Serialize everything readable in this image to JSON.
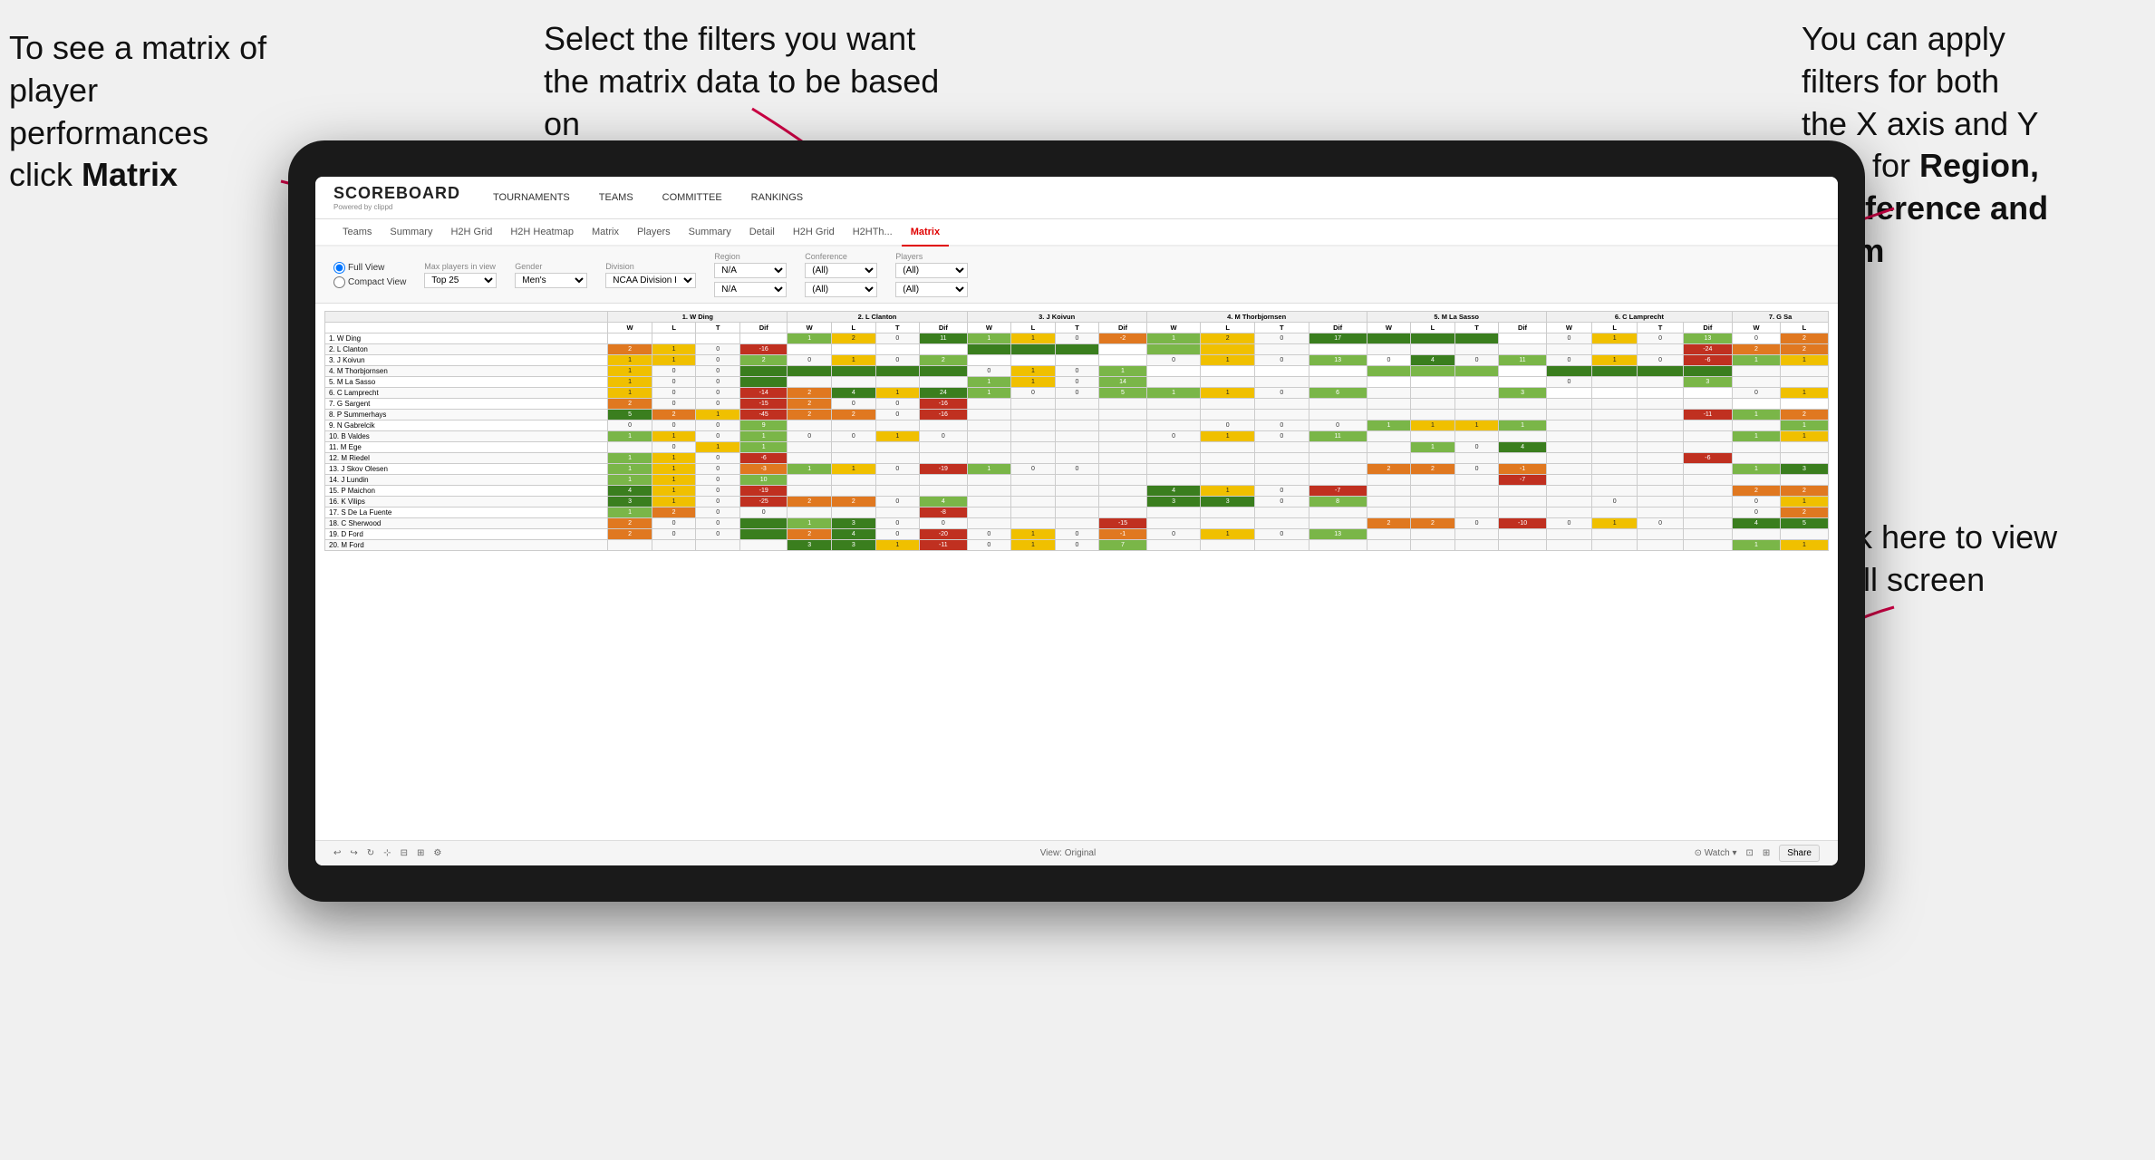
{
  "annotations": {
    "topleft": {
      "line1": "To see a matrix of",
      "line2": "player performances",
      "line3_normal": "click ",
      "line3_bold": "Matrix"
    },
    "topmid": {
      "text": "Select the filters you want the matrix data to be based on"
    },
    "topright": {
      "line1": "You  can apply",
      "line2": "filters for both",
      "line3": "the X axis and Y",
      "line4_normal": "Axis for ",
      "line4_bold": "Region,",
      "line5_bold": "Conference and",
      "line6_bold": "Team"
    },
    "bottomright": {
      "line1": "Click here to view",
      "line2": "in full screen"
    }
  },
  "app": {
    "logo": "SCOREBOARD",
    "logo_sub": "Powered by clippd",
    "nav_items": [
      "TOURNAMENTS",
      "TEAMS",
      "COMMITTEE",
      "RANKINGS"
    ],
    "sub_nav": [
      "Teams",
      "Summary",
      "H2H Grid",
      "H2H Heatmap",
      "Matrix",
      "Players",
      "Summary",
      "Detail",
      "H2H Grid",
      "H2HTh...",
      "Matrix"
    ],
    "active_tab": "Matrix",
    "filters": {
      "view_options": [
        "Full View",
        "Compact View"
      ],
      "max_players_label": "Max players in view",
      "max_players_value": "Top 25",
      "gender_label": "Gender",
      "gender_value": "Men's",
      "division_label": "Division",
      "division_value": "NCAA Division I",
      "region_label": "Region",
      "region_value": "N/A",
      "conference_label": "Conference",
      "conference_value": "(All)",
      "players_label": "Players",
      "players_value": "(All)"
    },
    "column_headers": [
      "1. W Ding",
      "2. L Clanton",
      "3. J Koivun",
      "4. M Thorbjornsen",
      "5. M La Sasso",
      "6. C Lamprecht",
      "7. G Sa"
    ],
    "sub_headers": [
      "W",
      "L",
      "T",
      "Dif"
    ],
    "rows": [
      {
        "name": "1. W Ding",
        "cells": [
          {
            "type": "empty"
          },
          {
            "type": "empty"
          },
          {
            "type": "empty"
          },
          {
            "type": "empty"
          },
          {
            "val": "1",
            "type": "green"
          },
          {
            "val": "2",
            "type": "yellow"
          },
          {
            "val": "0",
            "type": "empty"
          },
          {
            "val": "11",
            "type": "green"
          },
          {
            "val": "1",
            "type": "green"
          },
          {
            "val": "1",
            "type": "yellow"
          },
          {
            "val": "0",
            "type": "empty"
          },
          {
            "val": "-2",
            "type": "orange"
          },
          {
            "val": "1",
            "type": "green"
          },
          {
            "val": "2",
            "type": "yellow"
          },
          {
            "val": "0",
            "type": "empty"
          },
          {
            "val": "17",
            "type": "green-dark"
          },
          {
            "val": "",
            "type": "green"
          },
          {
            "val": "",
            "type": "green"
          },
          {
            "val": "",
            "type": "green"
          },
          {
            "val": "",
            "type": "empty"
          },
          {
            "val": "0",
            "type": "empty"
          },
          {
            "val": "1",
            "type": "yellow"
          },
          {
            "val": "0",
            "type": "empty"
          },
          {
            "val": "13",
            "type": "green"
          },
          {
            "val": "0",
            "type": "empty"
          },
          {
            "val": "2",
            "type": "orange"
          }
        ]
      },
      {
        "name": "2. L Clanton",
        "cells": []
      },
      {
        "name": "3. J Koivun",
        "cells": []
      },
      {
        "name": "4. M Thorbjornsen",
        "cells": []
      },
      {
        "name": "5. M La Sasso",
        "cells": []
      },
      {
        "name": "6. C Lamprecht",
        "cells": []
      },
      {
        "name": "7. G Sargent",
        "cells": []
      },
      {
        "name": "8. P Summerhays",
        "cells": []
      },
      {
        "name": "9. N Gabrelcik",
        "cells": []
      },
      {
        "name": "10. B Valdes",
        "cells": []
      },
      {
        "name": "11. M Ege",
        "cells": []
      },
      {
        "name": "12. M Riedel",
        "cells": []
      },
      {
        "name": "13. J Skov Olesen",
        "cells": []
      },
      {
        "name": "14. J Lundin",
        "cells": []
      },
      {
        "name": "15. P Maichon",
        "cells": []
      },
      {
        "name": "16. K Vilips",
        "cells": []
      },
      {
        "name": "17. S De La Fuente",
        "cells": []
      },
      {
        "name": "18. C Sherwood",
        "cells": []
      },
      {
        "name": "19. D Ford",
        "cells": []
      },
      {
        "name": "20. M Ford",
        "cells": []
      }
    ],
    "toolbar": {
      "view_label": "View: Original",
      "watch_label": "Watch",
      "share_label": "Share"
    }
  },
  "colors": {
    "accent": "#e00000",
    "green_dark": "#4a7c2a",
    "green": "#7ab648",
    "yellow": "#f0c000",
    "orange": "#e07820",
    "red": "#c03020"
  }
}
